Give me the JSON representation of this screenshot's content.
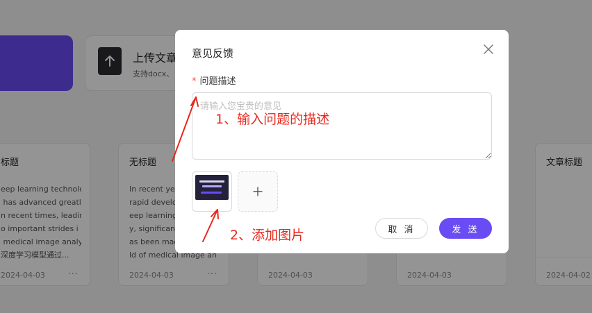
{
  "background": {
    "upload": {
      "title": "上传文章",
      "subtitle": "支持docx、"
    },
    "cards": [
      {
        "title": "标题",
        "snippet": "eep learning technolo\n has advanced greatl\nn recent times, leadin\no important strides i\n medical image analys\n深度学习模型通过...",
        "date": "2024-04-03",
        "more": "···"
      },
      {
        "title": "无标题",
        "snippet": "In recent yea\nrapid develo\neep learning\ny, significant\nas been mad\nld of medical image an",
        "date": "2024-04-03",
        "more": "···"
      },
      {
        "title": "",
        "snippet": "",
        "date": "2024-04-03",
        "more": ""
      },
      {
        "title": "",
        "snippet": "",
        "date": "2024-04-03",
        "more": ""
      },
      {
        "title": "文章标题",
        "snippet": "",
        "date": "2024-04-02",
        "more": ""
      }
    ]
  },
  "modal": {
    "title": "意见反馈",
    "field_label": "问题描述",
    "required_mark": "*",
    "placeholder": "请输入您宝贵的意见",
    "cancel_label": "取 消",
    "send_label": "发 送"
  },
  "annotations": {
    "step1": "1、输入问题的描述",
    "step2": "2、添加图片"
  },
  "colors": {
    "accent": "#6a4cf5",
    "annotation": "#e8271d",
    "required": "#ff4d4f"
  }
}
